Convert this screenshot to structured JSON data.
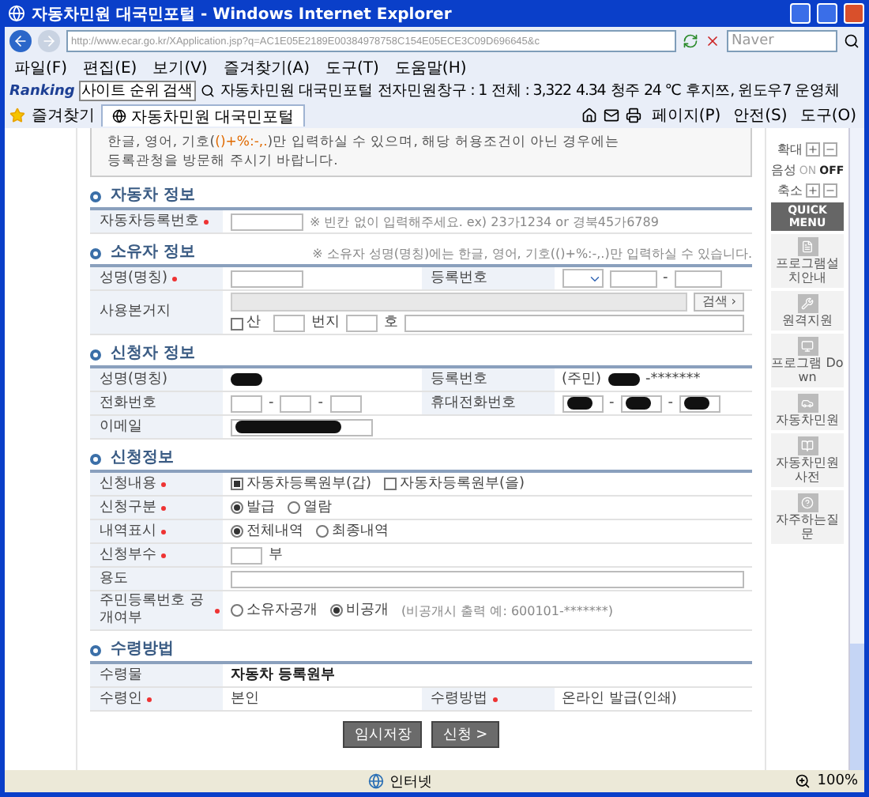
{
  "window": {
    "title": "자동차민원 대국민포털 - Windows Internet Explorer"
  },
  "address_bar": {
    "url": "http://www.ecar.go.kr/XApplication.jsp?q=AC1E05E2189E00384978758C154E05ECE3C09D696645&c",
    "search_placeholder": "Naver"
  },
  "menu": [
    "파일(F)",
    "편집(E)",
    "보기(V)",
    "즐겨찾기(A)",
    "도구(T)",
    "도움말(H)"
  ],
  "toolbar": {
    "brand": "Ranking",
    "search_value": "사이트 순위 검색",
    "items": [
      "자동차민원 대국민포털",
      "전자민원창구 : 1",
      "전체 : 3,322",
      "4.34",
      "청주 24 ℃",
      "후지쯔, 윈도우7 운영체"
    ]
  },
  "favorites_bar": {
    "label": "즐겨찾기",
    "tab": "자동차민원 대국민포털",
    "commands": [
      "페이지(P)",
      "안전(S)",
      "도구(O)"
    ]
  },
  "notice": {
    "before": "한글, 영어, 기호(",
    "highlight": "()+%:-,.",
    "after": ")만 입력하실 수 있으며, 해당 허용조건이 아닌 경우에는",
    "line2": "등록관청을 방문해 주시기 바랍니다."
  },
  "sections": [
    {
      "title": "자동차 정보",
      "rows": [
        {
          "cells": [
            {
              "label": "자동차등록번호",
              "required": true,
              "controls": [
                {
                  "kind": "field_m"
                },
                {
                  "kind": "hint",
                  "text": "※ 빈칸 없이 입력해주세요. ex) 23가1234 or 경북45가6789"
                }
              ]
            }
          ]
        }
      ]
    },
    {
      "title": "소유자 정보",
      "note": "※ 소유자 성명(명칭)에는 한글, 영어, 기호(()+%:-,.)만 입력하실 수 있습니다.",
      "rows": [
        {
          "cells": [
            {
              "label": "성명(명칭)",
              "required": true,
              "controls": [
                {
                  "kind": "field_m"
                }
              ]
            },
            {
              "label": "등록번호",
              "required": false,
              "controls": [
                {
                  "kind": "select"
                },
                {
                  "kind": "field_s"
                },
                {
                  "kind": "text",
                  "text": "-"
                },
                {
                  "kind": "field_s"
                }
              ]
            }
          ]
        },
        {
          "cells": [
            {
              "label": "사용본거지",
              "required": false,
              "controls": [
                {
                  "kind": "disabled_field"
                },
                {
                  "kind": "button",
                  "text": "검색 ›"
                },
                {
                  "kind": "break"
                },
                {
                  "kind": "checkbox",
                  "text": "산",
                  "checked": false
                },
                {
                  "kind": "field_xs"
                },
                {
                  "kind": "text",
                  "text": "번지"
                },
                {
                  "kind": "field_xs"
                },
                {
                  "kind": "text",
                  "text": "호"
                },
                {
                  "kind": "field_full"
                }
              ]
            }
          ]
        }
      ]
    },
    {
      "title": "신청자 정보",
      "rows": [
        {
          "cells": [
            {
              "label": "성명(명칭)",
              "required": false,
              "controls": [
                {
                  "kind": "redacted"
                }
              ]
            },
            {
              "label": "등록번호",
              "required": false,
              "controls": [
                {
                  "kind": "text",
                  "text": "(주민)"
                },
                {
                  "kind": "redacted"
                },
                {
                  "kind": "text",
                  "text": "-*******"
                }
              ]
            }
          ]
        },
        {
          "cells": [
            {
              "label": "전화번호",
              "required": false,
              "controls": [
                {
                  "kind": "field_xs"
                },
                {
                  "kind": "text",
                  "text": "-"
                },
                {
                  "kind": "field_xs"
                },
                {
                  "kind": "text",
                  "text": "-"
                },
                {
                  "kind": "field_xs"
                }
              ]
            },
            {
              "label": "휴대전화번호",
              "required": false,
              "controls": [
                {
                  "kind": "redacted_field"
                },
                {
                  "kind": "text",
                  "text": "-"
                },
                {
                  "kind": "redacted_field"
                },
                {
                  "kind": "text",
                  "text": "-"
                },
                {
                  "kind": "redacted_field"
                }
              ]
            }
          ]
        },
        {
          "cells": [
            {
              "label": "이메일",
              "required": false,
              "controls": [
                {
                  "kind": "redacted_wide_field"
                }
              ]
            }
          ]
        }
      ]
    },
    {
      "title": "신청정보",
      "rows": [
        {
          "cells": [
            {
              "label": "신청내용",
              "required": true,
              "controls": [
                {
                  "kind": "checkbox",
                  "text": "자동차등록원부(갑)",
                  "checked": true
                },
                {
                  "kind": "checkbox",
                  "text": "자동차등록원부(을)",
                  "checked": false
                }
              ]
            }
          ]
        },
        {
          "cells": [
            {
              "label": "신청구분",
              "required": true,
              "controls": [
                {
                  "kind": "radio",
                  "text": "발급",
                  "selected": true
                },
                {
                  "kind": "radio",
                  "text": "열람",
                  "selected": false
                }
              ]
            }
          ]
        },
        {
          "cells": [
            {
              "label": "내역표시",
              "required": true,
              "controls": [
                {
                  "kind": "radio",
                  "text": "전체내역",
                  "selected": true
                },
                {
                  "kind": "radio",
                  "text": "최종내역",
                  "selected": false
                }
              ]
            }
          ]
        },
        {
          "cells": [
            {
              "label": "신청부수",
              "required": true,
              "controls": [
                {
                  "kind": "field_xs"
                },
                {
                  "kind": "text",
                  "text": "부"
                }
              ]
            }
          ]
        },
        {
          "cells": [
            {
              "label": "용도",
              "required": false,
              "controls": [
                {
                  "kind": "field_full"
                }
              ]
            }
          ]
        },
        {
          "cells": [
            {
              "label": "주민등록번호 공개여부",
              "required": true,
              "controls": [
                {
                  "kind": "radio",
                  "text": "소유자공개",
                  "selected": false
                },
                {
                  "kind": "radio",
                  "text": "비공개",
                  "selected": true
                },
                {
                  "kind": "hint",
                  "text": "(비공개시 출력 예: 600101-*******)"
                }
              ]
            }
          ]
        }
      ]
    },
    {
      "title": "수령방법",
      "rows": [
        {
          "cells": [
            {
              "label": "수령물",
              "required": false,
              "controls": [
                {
                  "kind": "strong",
                  "text": "자동차 등록원부"
                }
              ]
            }
          ]
        },
        {
          "cells": [
            {
              "label": "수령인",
              "required": true,
              "controls": [
                {
                  "kind": "text",
                  "text": "본인"
                }
              ]
            },
            {
              "label": "수령방법",
              "required": true,
              "controls": [
                {
                  "kind": "text",
                  "text": "온라인 발급(인쇄)"
                }
              ]
            }
          ]
        }
      ]
    }
  ],
  "buttons": [
    "임시저장",
    "신청 >"
  ],
  "sidebar": {
    "zoom_in": "확대",
    "voice": "음성",
    "on": "ON",
    "off": "OFF",
    "voice_on": false,
    "zoom_out": "축소",
    "title": "QUICK MENU",
    "items": [
      "프로그램설치안내",
      "원격지원",
      "프로그램 Down",
      "자동차민원",
      "자동차민원사전",
      "자주하는질문"
    ]
  },
  "status_bar": {
    "zone": "인터넷",
    "zoom": "100%"
  }
}
